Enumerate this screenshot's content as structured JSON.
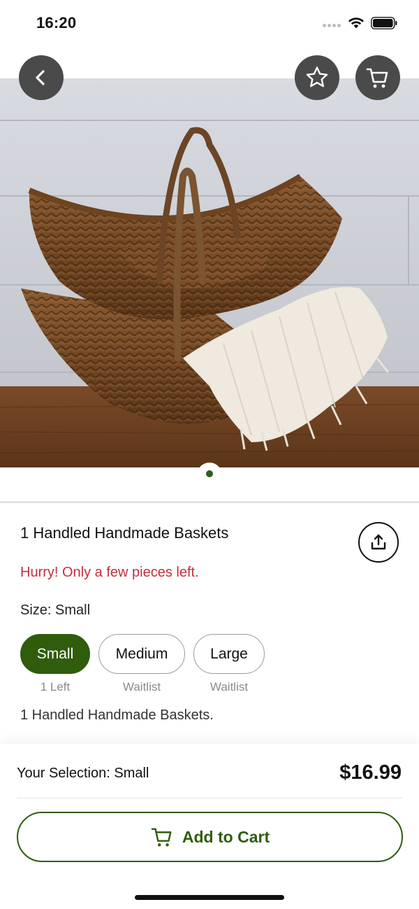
{
  "status_bar": {
    "time": "16:20"
  },
  "product": {
    "title": "1 Handled Handmade Baskets",
    "stock_warning": "Hurry! Only a few pieces left.",
    "size_label": "Size: Small",
    "description": "1 Handled Handmade Baskets.",
    "image_count": 1,
    "current_image": 1
  },
  "sizes": [
    {
      "label": "Small",
      "status": "1 Left",
      "selected": true
    },
    {
      "label": "Medium",
      "status": "Waitlist",
      "selected": false
    },
    {
      "label": "Large",
      "status": "Waitlist",
      "selected": false
    }
  ],
  "footer": {
    "selection_text": "Your Selection: Small",
    "price": "$16.99",
    "add_to_cart_label": "Add to Cart"
  },
  "icons": {
    "back": "chevron-left-icon",
    "favorite": "star-icon",
    "cart": "cart-icon",
    "share": "share-icon"
  },
  "colors": {
    "accent_green": "#2f5d0c",
    "warning_red": "#c62d3c",
    "floating_button": "#4a4a4a"
  }
}
